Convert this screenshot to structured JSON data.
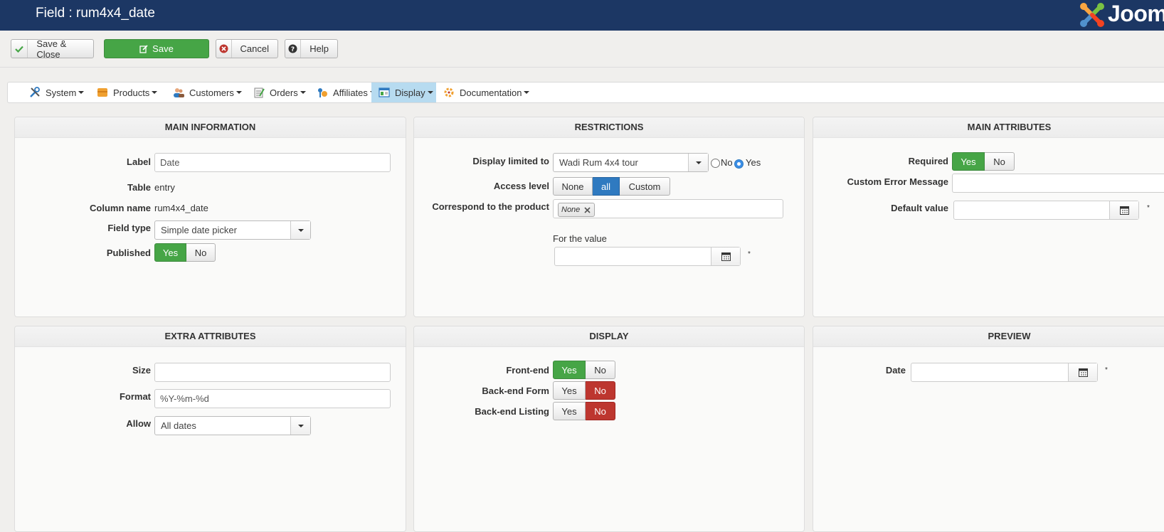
{
  "header": {
    "title": "Field : rum4x4_date",
    "logo_text": "Joomla!"
  },
  "toolbar": {
    "save_close": "Save & Close",
    "save": "Save",
    "cancel": "Cancel",
    "help": "Help"
  },
  "menu": {
    "items": [
      {
        "label": "System",
        "icon": "tools-icon"
      },
      {
        "label": "Products",
        "icon": "products-icon"
      },
      {
        "label": "Customers",
        "icon": "customers-icon"
      },
      {
        "label": "Orders",
        "icon": "orders-icon"
      },
      {
        "label": "Affiliates",
        "icon": "affiliates-icon"
      },
      {
        "label": "Display",
        "icon": "display-icon",
        "active": true
      },
      {
        "label": "Documentation",
        "icon": "documentation-icon"
      }
    ]
  },
  "main_information": {
    "heading": "MAIN INFORMATION",
    "label_label": "Label",
    "label_value": "Date",
    "table_label": "Table",
    "table_value": "entry",
    "column_label": "Column name",
    "column_value": "rum4x4_date",
    "fieldtype_label": "Field type",
    "fieldtype_value": "Simple date picker",
    "published_label": "Published",
    "yes": "Yes",
    "no": "No",
    "published_selected": "Yes"
  },
  "restrictions": {
    "heading": "RESTRICTIONS",
    "display_limited_label": "Display limited to",
    "display_limited_value": "Wadi Rum 4x4 tour",
    "radio_no": "No",
    "radio_yes": "Yes",
    "radio_selected": "Yes",
    "access_label": "Access level",
    "access_none": "None",
    "access_all": "all",
    "access_custom": "Custom",
    "access_selected": "all",
    "correspond_label": "Correspond to the product",
    "correspond_tag": "None",
    "for_value_label": "For the value",
    "for_value_value": "",
    "required_mark": "*"
  },
  "main_attributes": {
    "heading": "MAIN ATTRIBUTES",
    "required_label": "Required",
    "yes": "Yes",
    "no": "No",
    "required_selected": "Yes",
    "error_label": "Custom Error Message",
    "error_value": "",
    "default_label": "Default value",
    "default_value": "",
    "required_mark": "*"
  },
  "extra_attributes": {
    "heading": "EXTRA ATTRIBUTES",
    "size_label": "Size",
    "size_value": "",
    "format_label": "Format",
    "format_value": "%Y-%m-%d",
    "allow_label": "Allow",
    "allow_value": "All dates"
  },
  "display": {
    "heading": "DISPLAY",
    "frontend_label": "Front-end",
    "backend_form_label": "Back-end Form",
    "backend_listing_label": "Back-end Listing",
    "yes": "Yes",
    "no": "No",
    "frontend_selected": "Yes",
    "backend_form_selected": "No",
    "backend_listing_selected": "No"
  },
  "preview": {
    "heading": "PREVIEW",
    "date_label": "Date",
    "date_value": "",
    "required_mark": "*"
  },
  "colors": {
    "header_bg": "#1c3764",
    "green": "#46a546",
    "red": "#bd362f",
    "blue": "#2f7ac0"
  }
}
